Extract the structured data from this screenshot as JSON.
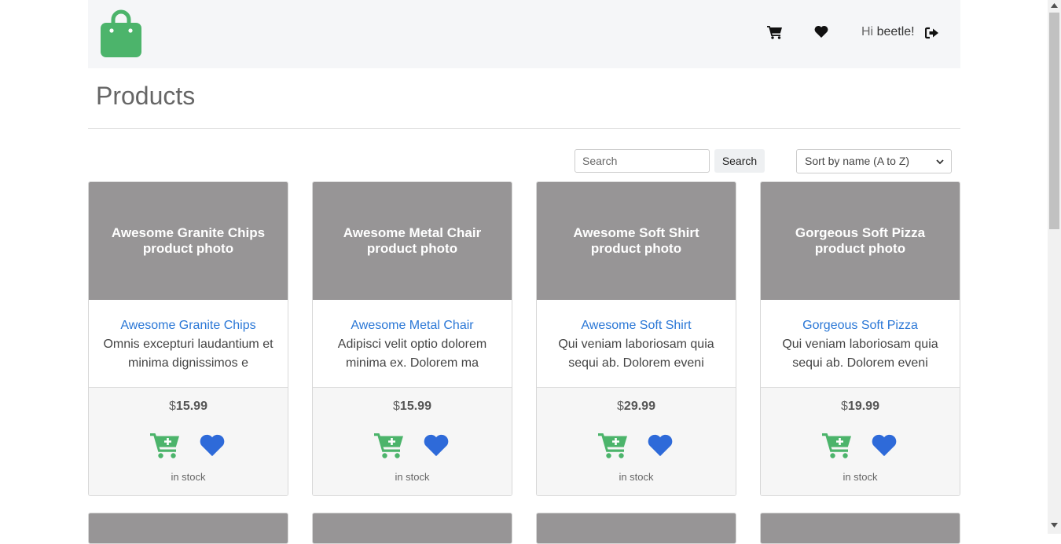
{
  "header": {
    "greeting_prefix": "Hi",
    "username": "beetle!",
    "brand_color": "#4cb46b"
  },
  "page": {
    "title": "Products"
  },
  "toolbar": {
    "search_placeholder": "Search",
    "search_button": "Search",
    "sort_selected": "Sort by name (A to Z)"
  },
  "products": [
    {
      "photo_label": "Awesome Granite Chips product photo",
      "name": "Awesome Granite Chips",
      "description": "Omnis excepturi laudantium et minima dignissimos e",
      "currency": "$",
      "price": "15.99",
      "stock": "in stock"
    },
    {
      "photo_label": "Awesome Metal Chair product photo",
      "name": "Awesome Metal Chair",
      "description": "Adipisci velit optio dolorem minima ex. Dolorem ma",
      "currency": "$",
      "price": "15.99",
      "stock": "in stock"
    },
    {
      "photo_label": "Awesome Soft Shirt product photo",
      "name": "Awesome Soft Shirt",
      "description": "Qui veniam laboriosam quia sequi ab. Dolorem eveni",
      "currency": "$",
      "price": "29.99",
      "stock": "in stock"
    },
    {
      "photo_label": "Gorgeous Soft Pizza product photo",
      "name": "Gorgeous Soft Pizza",
      "description": "Qui veniam laboriosam quia sequi ab. Dolorem eveni",
      "currency": "$",
      "price": "19.99",
      "stock": "in stock"
    }
  ],
  "colors": {
    "link": "#2a77d6",
    "cart_icon": "#4cb46b",
    "wishlist_icon": "#2e6ad9",
    "photo_placeholder": "#979596"
  },
  "icons": [
    "shopping-bag-logo-icon",
    "cart-icon",
    "heart-icon",
    "sign-out-icon",
    "cart-plus-icon",
    "chevron-down-icon"
  ]
}
